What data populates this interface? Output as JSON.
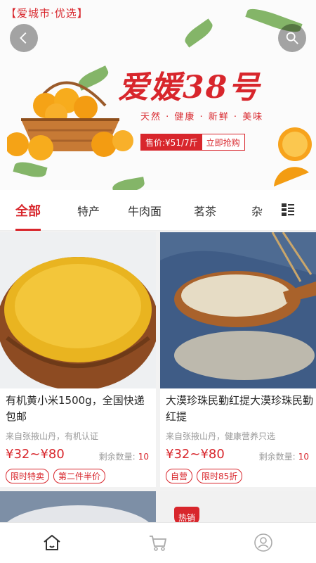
{
  "banner": {
    "tag": "【爱城市·优选】",
    "title": "爱媛38号",
    "subtitle": "天然 · 健康 · 新鲜 · 美味",
    "price_label": "售价:¥51/7斤",
    "cta_label": "立即抢购"
  },
  "tabs": [
    {
      "label": "全部"
    },
    {
      "label": "特产"
    },
    {
      "label": "牛肉面"
    },
    {
      "label": "茗茶"
    },
    {
      "label": "杂"
    }
  ],
  "products": [
    {
      "name": "有机黄小米1500g，全国快递包邮",
      "source": "来自张掖山丹，有机认证",
      "price": "¥32~¥80",
      "stock_label": "剩余数量:",
      "stock": "10",
      "tags": [
        "限时特卖",
        "第二件半价"
      ]
    },
    {
      "name": "大漠珍珠民勤红提大漠珍珠民勤红提",
      "source": "来自张掖山丹，健康营养只选",
      "price": "¥32~¥80",
      "stock_label": "剩余数量:",
      "stock": "10",
      "tags": [
        "自营",
        "限时85折"
      ]
    }
  ],
  "hot_badge": "热销",
  "colors": {
    "accent": "#d8262c"
  },
  "icons": [
    "back-icon",
    "search-icon",
    "menu-grid-icon",
    "home-icon",
    "cart-icon",
    "user-icon"
  ]
}
